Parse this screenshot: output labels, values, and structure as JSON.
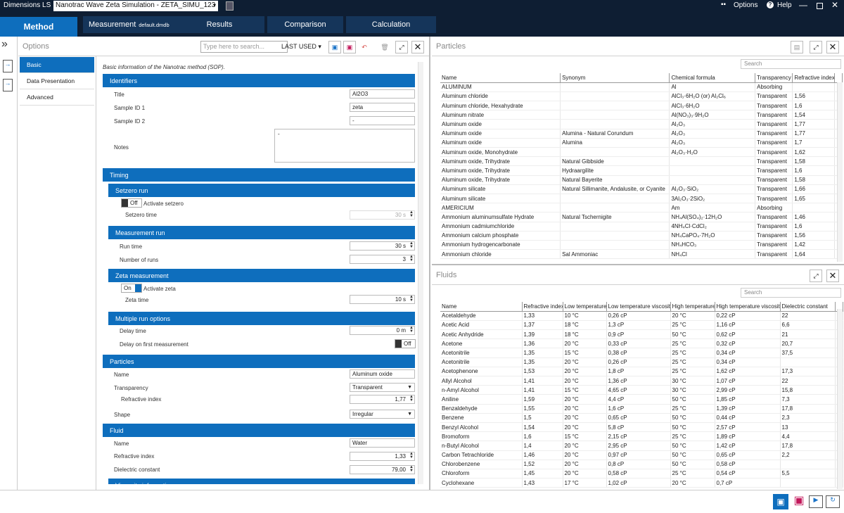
{
  "titlebar": {
    "app": "Dimensions LS",
    "document": "Nanotrac Wave Zeta Simulation - ZETA_SIMU_123",
    "options": "Options",
    "help": "Help"
  },
  "nav": {
    "method": "Method",
    "measurement": "Measurement",
    "measurement_file": "default.dmdb",
    "results": "Results",
    "comparison": "Comparison",
    "calculation": "Calculation"
  },
  "options": {
    "title": "Options",
    "search_placeholder": "Type here to search...",
    "last_used": "LAST USED",
    "tabs": [
      "Basic",
      "Data Presentation",
      "Advanced"
    ],
    "description": "Basic information of the Nanotrac method (SOP).",
    "identifiers": {
      "header": "Identifiers",
      "title_label": "Title",
      "title_value": "Al2O3",
      "sample1_label": "Sample ID 1",
      "sample1_value": "zeta",
      "sample2_label": "Sample ID 2",
      "sample2_value": "-",
      "notes_label": "Notes",
      "notes_value": "-"
    },
    "timing": {
      "header": "Timing",
      "setzero_header": "Setzero run",
      "setzero_toggle": "Off",
      "setzero_activate": "Activate setzero",
      "setzero_time_label": "Setzero time",
      "setzero_time": "30 s",
      "meas_header": "Measurement run",
      "run_time_label": "Run time",
      "run_time": "30 s",
      "num_runs_label": "Number of runs",
      "num_runs": "3",
      "zeta_header": "Zeta measurement",
      "zeta_toggle": "On",
      "zeta_activate": "Activate zeta",
      "zeta_time_label": "Zeta time",
      "zeta_time": "10 s",
      "multi_header": "Multiple run options",
      "delay_label": "Delay time",
      "delay": "0 m",
      "delay_first_label": "Delay on first measurement",
      "delay_first": "Off"
    },
    "particles": {
      "header": "Particles",
      "name_label": "Name",
      "name_value": "Aluminum oxide",
      "transparency_label": "Transparency",
      "transparency_value": "Transparent",
      "refr_label": "Refractive index",
      "refr_value": "1,77",
      "shape_label": "Shape",
      "shape_value": "Irregular"
    },
    "fluid": {
      "header": "Fluid",
      "name_label": "Name",
      "name_value": "Water",
      "refr_label": "Refractive index",
      "refr_value": "1,33",
      "diel_label": "Dielectric constant",
      "diel_value": "79,00",
      "visc_header": "Viscosity information"
    }
  },
  "particles_panel": {
    "title": "Particles",
    "search": "Search",
    "columns": [
      "Name",
      "Synonym",
      "Chemical formula",
      "Transparency",
      "Refractive index"
    ],
    "rows": [
      [
        "ALUMINUM",
        "",
        "Al",
        "Absorbing",
        ""
      ],
      [
        "Aluminum chloride",
        "",
        "AlCl₃·6H₂O (or) Al₂Cl₆",
        "Transparent",
        "1,56"
      ],
      [
        "Aluminum chloride, Hexahydrate",
        "",
        "AlCl₃·6H₂O",
        "Transparent",
        "1,6"
      ],
      [
        "Aluminum nitrate",
        "",
        "Al(NO₃)₃·9H₂O",
        "Transparent",
        "1,54"
      ],
      [
        "Aluminum oxide",
        "",
        "Al₂O₃",
        "Transparent",
        "1,77"
      ],
      [
        "Aluminum oxide",
        "Alumina - Natural Corundum",
        "Al₂O₃",
        "Transparent",
        "1,77"
      ],
      [
        "Aluminum oxide",
        "Alumina",
        "Al₂O₃",
        "Transparent",
        "1,7"
      ],
      [
        "Aluminum oxide, Monohydrate",
        "",
        "Al₂O₃·H₂O",
        "Transparent",
        "1,62"
      ],
      [
        "Aluminum oxide, Trihydrate",
        "Natural Gibbside",
        "",
        "Transparent",
        "1,58"
      ],
      [
        "Aluminum oxide, Trihydrate",
        "Hydraargilite",
        "",
        "Transparent",
        "1,6"
      ],
      [
        "Aluminum oxide, Trihydrate",
        "Natural Bayerite",
        "",
        "Transparent",
        "1,58"
      ],
      [
        "Aluminum silicate",
        "Natural Sillimanite, Andalusite, or Cyanite",
        "Al₂O₃·SiO₂",
        "Transparent",
        "1,66"
      ],
      [
        "Aluminum silicate",
        "",
        "3Al₂O₃·2SiO₂",
        "Transparent",
        "1,65"
      ],
      [
        "AMERICIUM",
        "",
        "Am",
        "Absorbing",
        ""
      ],
      [
        "Ammonium aluminumsulfate Hydrate",
        "Natural Tschernigite",
        "NH₄Al(SO₄)₂·12H₂O",
        "Transparent",
        "1,46"
      ],
      [
        "Ammonium cadmiumchloride",
        "",
        "4NH₄Cl·CdCl₂",
        "Transparent",
        "1,6"
      ],
      [
        "Ammonium calcium phosphate",
        "",
        "NH₄CaPO₄·7H₂O",
        "Transparent",
        "1,56"
      ],
      [
        "Ammonium hydrogencarbonate",
        "",
        "NH₄HCO₃",
        "Transparent",
        "1,42"
      ],
      [
        "Ammonium chloride",
        "Sal Ammoniac",
        "NH₄Cl",
        "Transparent",
        "1,64"
      ]
    ]
  },
  "fluids_panel": {
    "title": "Fluids",
    "search": "Search",
    "columns": [
      "Name",
      "Refractive index",
      "Low temperature",
      "Low temperature viscosity",
      "High temperature",
      "High temperature viscosity",
      "Dielectric constant"
    ],
    "rows": [
      [
        "Acetaldehyde",
        "1,33",
        "10 °C",
        "0,26 cP",
        "20 °C",
        "0,22 cP",
        "22"
      ],
      [
        "Acetic Acid",
        "1,37",
        "18 °C",
        "1,3 cP",
        "25 °C",
        "1,16 cP",
        "6,6"
      ],
      [
        "Acetic Anhydride",
        "1,39",
        "18 °C",
        "0,9 cP",
        "50 °C",
        "0,62 cP",
        "21"
      ],
      [
        "Acetone",
        "1,36",
        "20 °C",
        "0,33 cP",
        "25 °C",
        "0,32 cP",
        "20,7"
      ],
      [
        "Acetonitrile",
        "1,35",
        "15 °C",
        "0,38 cP",
        "25 °C",
        "0,34 cP",
        "37,5"
      ],
      [
        "Acetonitrile",
        "1,35",
        "20 °C",
        "0,26 cP",
        "25 °C",
        "0,34 cP",
        ""
      ],
      [
        "Acetophenone",
        "1,53",
        "20 °C",
        "1,8 cP",
        "25 °C",
        "1,62 cP",
        "17,3"
      ],
      [
        "Allyl Alcohol",
        "1,41",
        "20 °C",
        "1,36 cP",
        "30 °C",
        "1,07 cP",
        "22"
      ],
      [
        "n-Amyl Alcohol",
        "1,41",
        "15 °C",
        "4,65 cP",
        "30 °C",
        "2,99 cP",
        "15,8"
      ],
      [
        "Aniline",
        "1,59",
        "20 °C",
        "4,4 cP",
        "50 °C",
        "1,85 cP",
        "7,3"
      ],
      [
        "Benzaldehyde",
        "1,55",
        "20 °C",
        "1,6 cP",
        "25 °C",
        "1,39 cP",
        "17,8"
      ],
      [
        "Benzene",
        "1,5",
        "20 °C",
        "0,65 cP",
        "50 °C",
        "0,44 cP",
        "2,3"
      ],
      [
        "Benzyl Alcohol",
        "1,54",
        "20 °C",
        "5,8 cP",
        "50 °C",
        "2,57 cP",
        "13"
      ],
      [
        "Bromoform",
        "1,6",
        "15 °C",
        "2,15 cP",
        "25 °C",
        "1,89 cP",
        "4,4"
      ],
      [
        "n-Butyl Alcohol",
        "1,4",
        "20 °C",
        "2,95 cP",
        "50 °C",
        "1,42 cP",
        "17,8"
      ],
      [
        "Carbon Tetrachloride",
        "1,46",
        "20 °C",
        "0,97 cP",
        "50 °C",
        "0,65 cP",
        "2,2"
      ],
      [
        "Chlorobenzene",
        "1,52",
        "20 °C",
        "0,8 cP",
        "50 °C",
        "0,58 cP",
        ""
      ],
      [
        "Chloroform",
        "1,45",
        "20 °C",
        "0,58 cP",
        "25 °C",
        "0,54 cP",
        "5,5"
      ],
      [
        "Cyclohexane",
        "1,43",
        "17 °C",
        "1,02 cP",
        "20 °C",
        "0,7 cP",
        ""
      ]
    ]
  },
  "colors": {
    "titlebar": "#0e1e33",
    "accent": "#0e6ebd",
    "tab_active": "#0e6ebd",
    "nav_tab": "#15355a"
  }
}
